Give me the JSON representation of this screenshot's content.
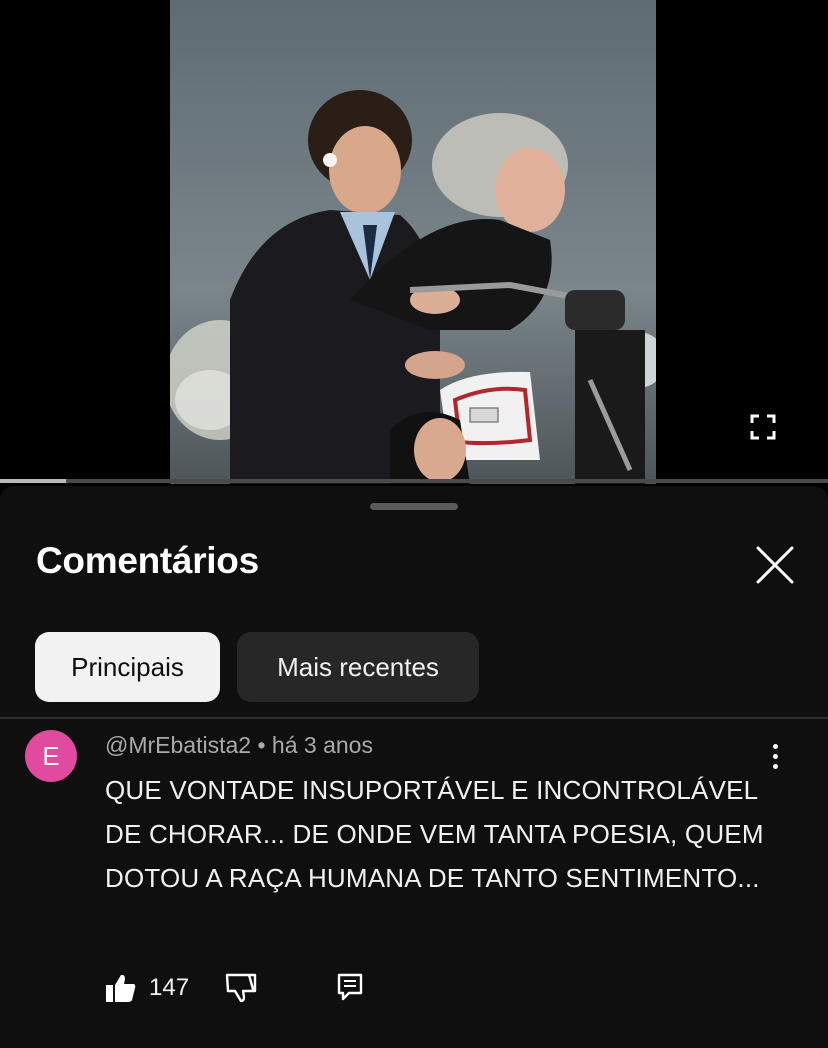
{
  "video": {
    "fullscreen_icon": "fullscreen-icon",
    "progress": 0.08
  },
  "comments_panel": {
    "title": "Comentários",
    "close_icon": "close-icon",
    "filters": [
      {
        "label": "Principais",
        "selected": true
      },
      {
        "label": "Mais recentes",
        "selected": false
      }
    ]
  },
  "comment": {
    "avatar_letter": "E",
    "avatar_color": "#e04b9f",
    "author": "@MrEbatista2",
    "time": "há 3 anos",
    "meta_separator": " • ",
    "text": "QUE VONTADE INSUPORTÁVEL E INCONTROLÁVEL DE CHORAR... DE ONDE VEM TANTA POESIA, QUEM DOTOU A RAÇA HUMANA DE TANTO SENTIMENTO...",
    "like_count": "147",
    "like_icon": "thumbs-up-icon",
    "dislike_icon": "thumbs-down-icon",
    "reply_icon": "reply-icon",
    "more_icon": "more-vertical-icon"
  }
}
